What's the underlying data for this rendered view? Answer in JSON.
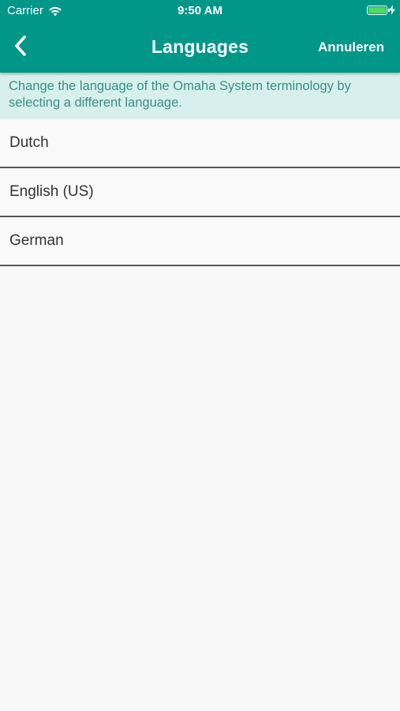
{
  "status_bar": {
    "carrier": "Carrier",
    "time": "9:50 AM",
    "battery_level": 1.0
  },
  "nav": {
    "title": "Languages",
    "cancel_label": "Annuleren",
    "back_icon": "chevron-left-icon"
  },
  "banner": {
    "text": "Change the language of the Omaha System terminology by selecting a different language."
  },
  "languages": [
    {
      "label": "Dutch"
    },
    {
      "label": "English (US)"
    },
    {
      "label": "German"
    }
  ],
  "colors": {
    "header": "#009688",
    "banner_bg": "#d7f0ed",
    "banner_text": "#3a8f86",
    "background": "#f8f8f8"
  }
}
